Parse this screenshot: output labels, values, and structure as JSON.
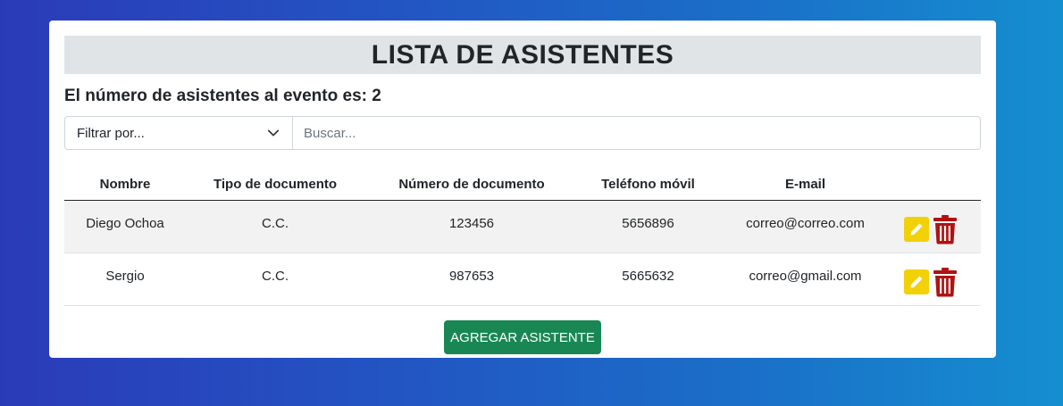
{
  "header": {
    "title": "LISTA DE ASISTENTES",
    "count_text": "El número de asistentes al evento es: 2"
  },
  "filters": {
    "select_value": "Filtrar por...",
    "search_placeholder": "Buscar..."
  },
  "table": {
    "columns": [
      "Nombre",
      "Tipo de documento",
      "Número de documento",
      "Teléfono móvil",
      "E-mail"
    ],
    "rows": [
      {
        "nombre": "Diego Ochoa",
        "tipo": "C.C.",
        "numero": "123456",
        "telefono": "5656896",
        "email": "correo@correo.com"
      },
      {
        "nombre": "Sergio",
        "tipo": "C.C.",
        "numero": "987653",
        "telefono": "5665632",
        "email": "correo@gmail.com"
      }
    ],
    "icons": {
      "edit": "pencil-icon",
      "delete": "trash-icon"
    }
  },
  "actions": {
    "add_label": "AGREGAR ASISTENTE"
  },
  "colors": {
    "edit_button": "#f2d109",
    "delete_icon": "#b01212",
    "add_button": "#198754",
    "title_bar": "#e1e4e6"
  }
}
